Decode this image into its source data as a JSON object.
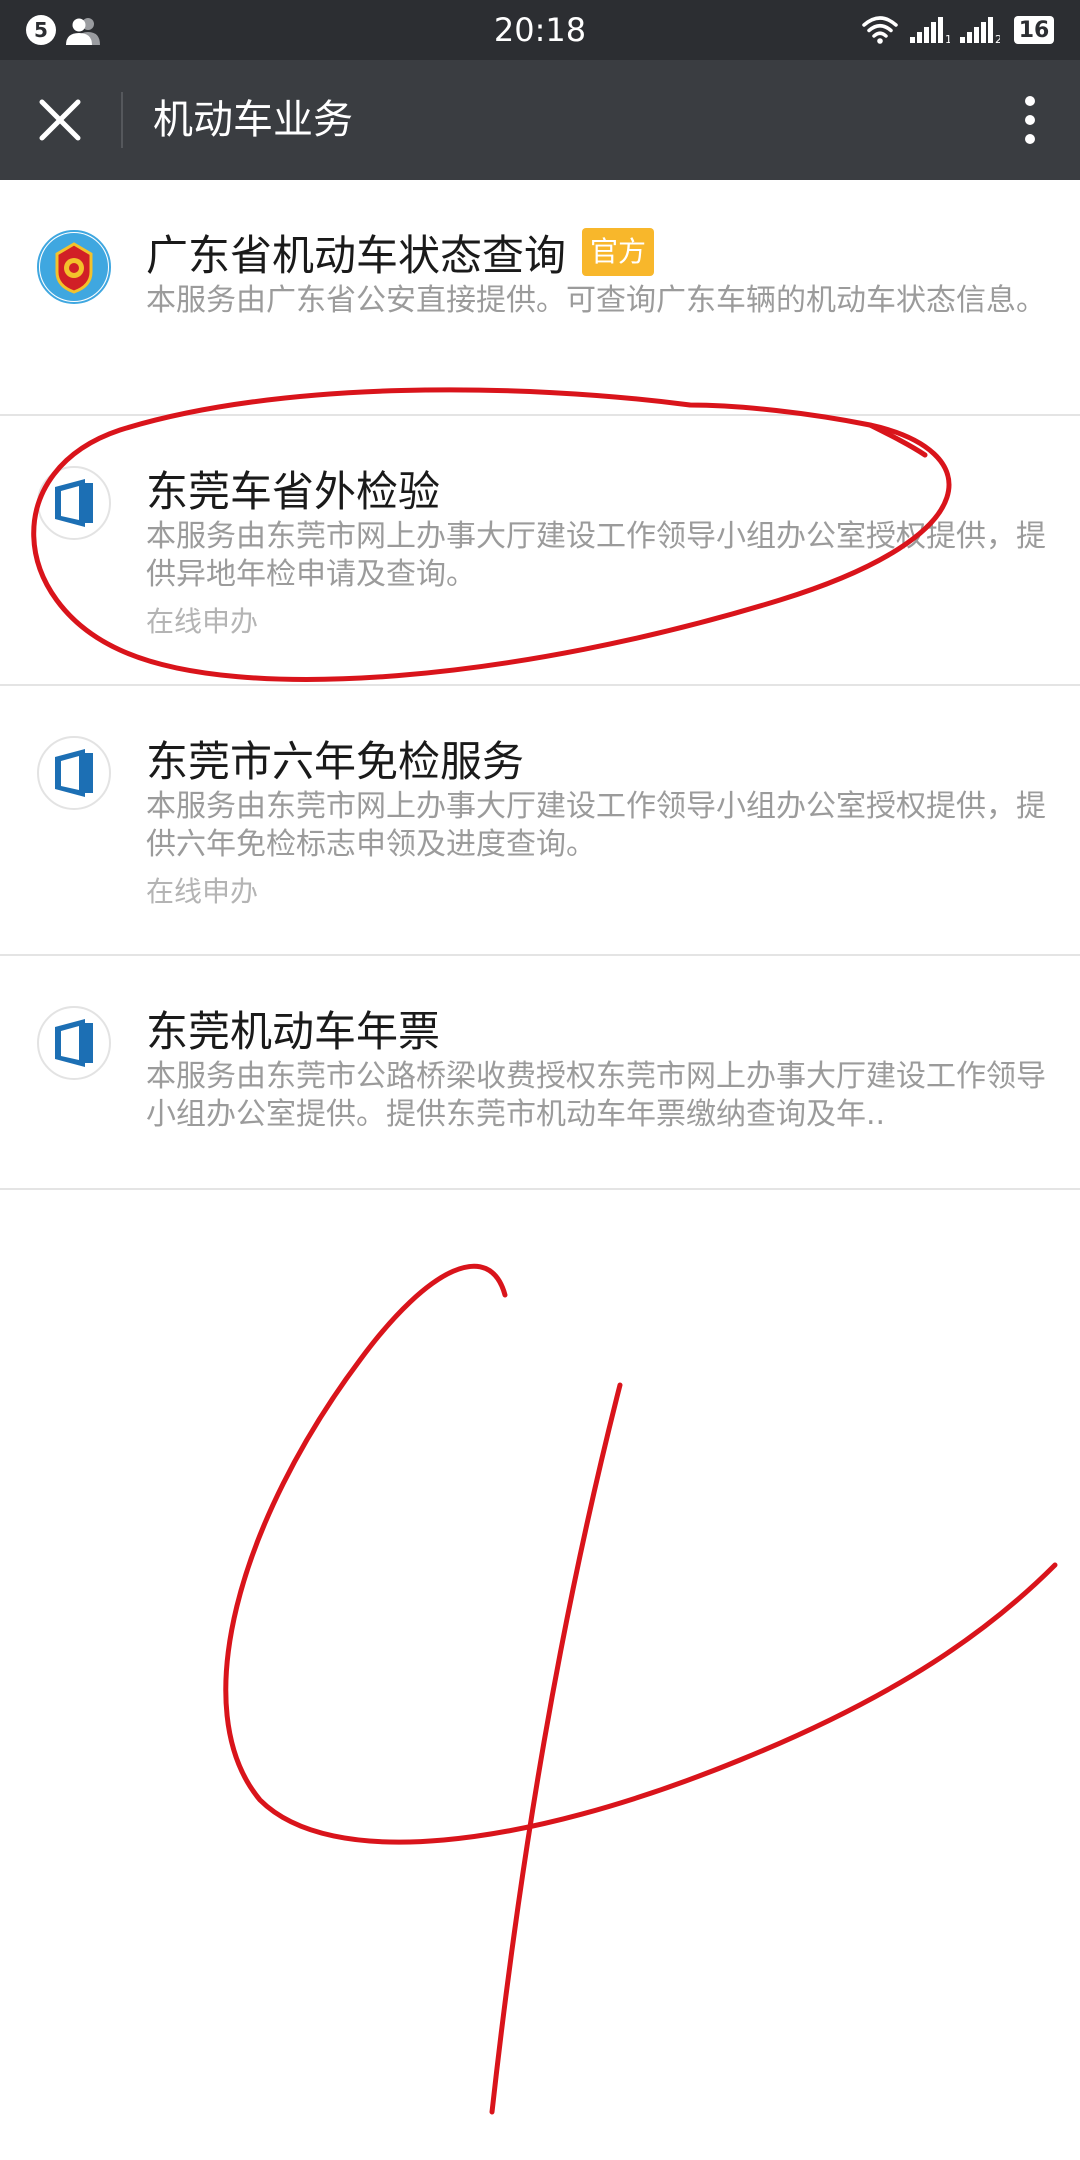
{
  "status_bar": {
    "notification_count": "5",
    "time": "20:18",
    "battery": "16",
    "sim1_label": "1",
    "sim2_label": "2"
  },
  "header": {
    "title": "机动车业务"
  },
  "services": [
    {
      "title": "广东省机动车状态查询",
      "badge": "官方",
      "description": "本服务由广东省公安直接提供。可查询广东车辆的机动车状态信息。",
      "logo": "police-emblem-icon"
    },
    {
      "title": "东莞车省外检验",
      "description": "本服务由东莞市网上办事大厅建设工作领导小组办公室授权提供，提供异地年检申请及查询。",
      "action": "在线申办",
      "logo": "dongguan-portal-icon"
    },
    {
      "title": "东莞市六年免检服务",
      "description": "本服务由东莞市网上办事大厅建设工作领导小组办公室授权提供，提供六年免检标志申领及进度查询。",
      "action": "在线申办",
      "logo": "dongguan-portal-icon"
    },
    {
      "title": "东莞机动车年票",
      "description": "本服务由东莞市公路桥梁收费授权东莞市网上办事大厅建设工作领导小组办公室提供。提供东莞市机动车年票缴纳查询及年..",
      "logo": "dongguan-portal-icon"
    }
  ],
  "colors": {
    "status_bar_bg": "#2c2e32",
    "title_bar_bg": "#3a3d41",
    "badge_bg": "#f8b72b",
    "annotation_red": "#d9141b"
  }
}
